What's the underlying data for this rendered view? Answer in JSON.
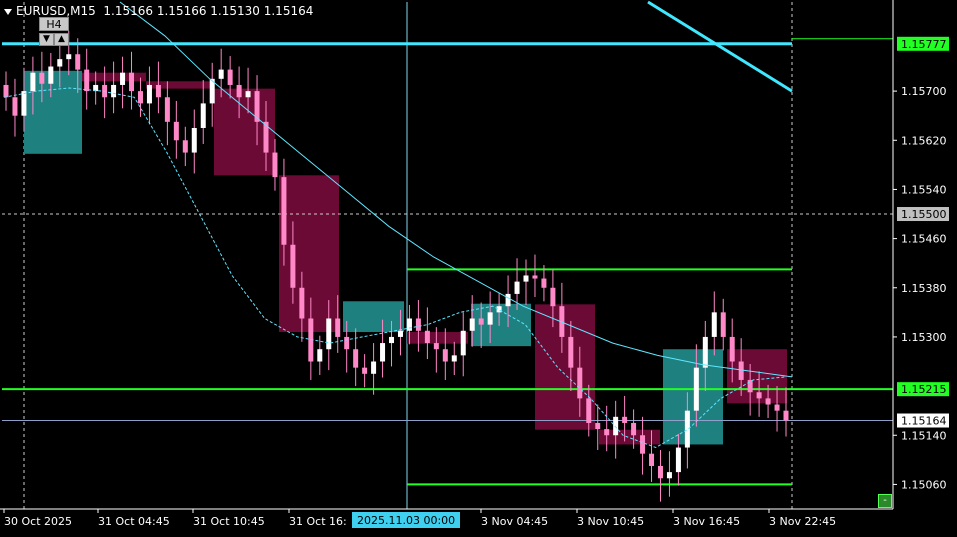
{
  "header": {
    "symbol": "EURUSD,M15",
    "ohlc": "1.15166 1.15166 1.15130 1.15164",
    "timeframe_button": "H4"
  },
  "icons": {
    "menu": "triangle-down-icon",
    "scroll_back": "triangle-down-icon",
    "scroll_forward": "triangle-up-icon"
  },
  "colors": {
    "background": "#000000",
    "bull_candle": "#ff88c8",
    "bear_candle": "#ff88c8",
    "bull_box": "#1f8080",
    "bear_box": "#6b0a35",
    "ma_line": "#5fe6ff",
    "level_cyan": "#40e8ff",
    "level_green": "#22ff22",
    "current_price_line": "#8fa0c8"
  },
  "price_axis": {
    "tick_labels": [
      "1.15700",
      "1.15620",
      "1.15540",
      "1.15460",
      "1.15380",
      "1.15300",
      "1.15140",
      "1.15060"
    ],
    "tag_green_top": "1.15777",
    "tag_grey": "1.15500",
    "tag_green_mid": "1.15215",
    "tag_current": "1.15164"
  },
  "time_axis": {
    "labels": [
      "30 Oct 2025",
      "31 Oct 04:45",
      "31 Oct 10:45",
      "31 Oct 16:",
      "3 Nov 04:45",
      "3 Nov 10:45",
      "3 Nov 16:45",
      "3 Nov 22:45"
    ],
    "crosshair_label": "2025.11.03 00:00"
  },
  "chart_data": {
    "type": "candlestick",
    "symbol": "EURUSD",
    "timeframe": "M15",
    "ylim": [
      1.1502,
      1.15845
    ],
    "levels": {
      "cyan_resistance": 1.15777,
      "grey_dotted": 1.155,
      "green_support": 1.15215,
      "green_range_high": 1.1541,
      "green_range_low": 1.1506,
      "current_price": 1.15164
    },
    "h4_boxes": [
      {
        "open": 1.15598,
        "close": 1.15733,
        "dir": "up"
      },
      {
        "open": 1.1573,
        "close": 1.15716,
        "dir": "down"
      },
      {
        "open": 1.15716,
        "close": 1.15704,
        "dir": "down"
      },
      {
        "open": 1.15704,
        "close": 1.15563,
        "dir": "down"
      },
      {
        "open": 1.15563,
        "close": 1.15308,
        "dir": "down"
      },
      {
        "open": 1.15308,
        "close": 1.15358,
        "dir": "up"
      },
      {
        "open": 1.15308,
        "close": 1.15289,
        "dir": "down"
      },
      {
        "open": 1.15285,
        "close": 1.15354,
        "dir": "up"
      },
      {
        "open": 1.15353,
        "close": 1.15149,
        "dir": "down"
      },
      {
        "open": 1.15149,
        "close": 1.15125,
        "dir": "down"
      },
      {
        "open": 1.15125,
        "close": 1.1528,
        "dir": "up"
      },
      {
        "open": 1.1528,
        "close": 1.15192,
        "dir": "down"
      }
    ],
    "m15_closes": [
      1.1569,
      1.1566,
      1.157,
      1.1573,
      1.15712,
      1.1574,
      1.15752,
      1.1576,
      1.15735,
      1.157,
      1.1571,
      1.1569,
      1.1571,
      1.1573,
      1.157,
      1.1568,
      1.1571,
      1.1569,
      1.1565,
      1.1562,
      1.156,
      1.1564,
      1.1568,
      1.1572,
      1.15735,
      1.1571,
      1.1569,
      1.157,
      1.1565,
      1.156,
      1.1556,
      1.1545,
      1.1538,
      1.1533,
      1.1526,
      1.1528,
      1.1533,
      1.153,
      1.1528,
      1.1525,
      1.1524,
      1.1526,
      1.1529,
      1.153,
      1.1531,
      1.1533,
      1.1531,
      1.1529,
      1.1528,
      1.1526,
      1.1527,
      1.1531,
      1.1533,
      1.1532,
      1.1534,
      1.1535,
      1.1537,
      1.1539,
      1.154,
      1.15395,
      1.1538,
      1.1535,
      1.153,
      1.1525,
      1.152,
      1.1516,
      1.1515,
      1.1514,
      1.1517,
      1.1516,
      1.1514,
      1.1511,
      1.1509,
      1.1507,
      1.1508,
      1.1512,
      1.1518,
      1.1525,
      1.153,
      1.1534,
      1.153,
      1.1526,
      1.1523,
      1.1521,
      1.152,
      1.1519,
      1.1518,
      1.15164
    ],
    "ma_fast": [
      1.1569,
      1.157,
      1.15705,
      1.157,
      1.1569,
      1.156,
      1.155,
      1.154,
      1.1533,
      1.153,
      1.1529,
      1.153,
      1.1531,
      1.1532,
      1.1534,
      1.1535,
      1.1532,
      1.1525,
      1.152,
      1.1514,
      1.1512,
      1.1515,
      1.152,
      1.1523,
      1.15235
    ],
    "ma_slow": [
      1.15845,
      1.1579,
      1.1572,
      1.1566,
      1.156,
      1.1554,
      1.1548,
      1.1543,
      1.1539,
      1.1535,
      1.1532,
      1.1529,
      1.1527,
      1.15255,
      1.15245,
      1.15235
    ],
    "top_right_line": [
      1.15845,
      1.157
    ]
  }
}
